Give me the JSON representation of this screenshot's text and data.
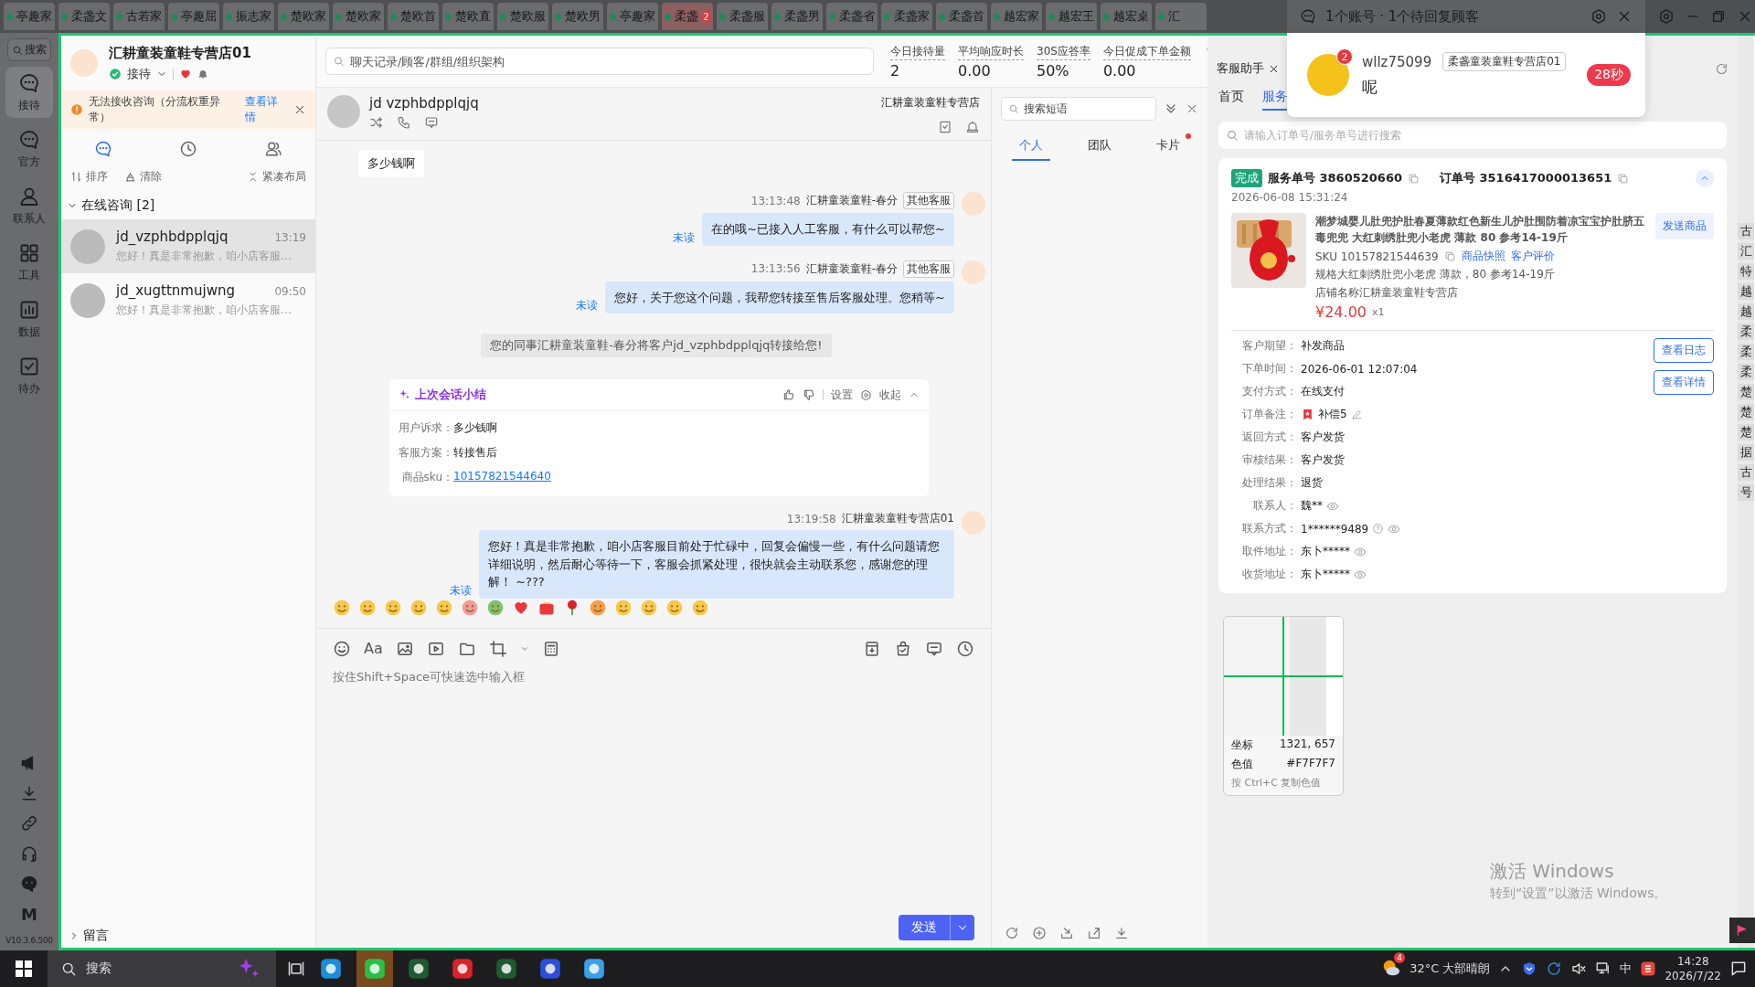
{
  "top_tabs": [
    {
      "label": "亭趣家",
      "alert": false
    },
    {
      "label": "柔盏文",
      "alert": false
    },
    {
      "label": "古若家",
      "alert": false
    },
    {
      "label": "亭趣屈",
      "alert": false
    },
    {
      "label": "振志家",
      "alert": false
    },
    {
      "label": "楚欧家",
      "alert": false
    },
    {
      "label": "楚欧家",
      "alert": false
    },
    {
      "label": "楚欧首",
      "alert": false
    },
    {
      "label": "楚欧直",
      "alert": false
    },
    {
      "label": "楚欧服",
      "alert": false
    },
    {
      "label": "楚欧男",
      "alert": false
    },
    {
      "label": "亭趣家",
      "alert": false
    },
    {
      "label": "柔盏",
      "alert": true,
      "badge": "2"
    },
    {
      "label": "柔盏服",
      "alert": false
    },
    {
      "label": "柔盏男",
      "alert": false
    },
    {
      "label": "柔盏省",
      "alert": false
    },
    {
      "label": "柔盏家",
      "alert": false
    },
    {
      "label": "柔盏首",
      "alert": false
    },
    {
      "label": "越宏家",
      "alert": false
    },
    {
      "label": "越宏王",
      "alert": false
    },
    {
      "label": "越宏桌",
      "alert": false
    },
    {
      "label": "汇",
      "alert": false
    }
  ],
  "notification": {
    "title": "1个账号 · 1个待回复顾客",
    "customer": "wllz75099",
    "badge": "2",
    "shop_tag": "柔盏童装童鞋专营店01",
    "message": "呢",
    "timer": "28秒"
  },
  "rail": {
    "search": "搜索",
    "items": [
      {
        "label": "接待",
        "selected": true
      },
      {
        "label": "官方",
        "selected": false
      },
      {
        "label": "联系人",
        "selected": false
      },
      {
        "label": "工具",
        "selected": false
      },
      {
        "label": "数据",
        "selected": false
      },
      {
        "label": "待办",
        "selected": false
      }
    ],
    "logo_letter": "M",
    "version": "V10.3.6.500"
  },
  "shop": {
    "name": "汇耕童装童鞋专营店01",
    "status": "接待"
  },
  "warning": {
    "text": "无法接收咨询（分流权重异常）",
    "link": "查看详情"
  },
  "list_tabs": [
    {
      "selected": true
    },
    {
      "selected": false
    },
    {
      "selected": false
    }
  ],
  "list_actions": [
    "排序",
    "清除",
    "紧凑布局"
  ],
  "group": {
    "label": "在线咨询 [2]",
    "expanded": true
  },
  "conversations": [
    {
      "name": "jd_vzphbdpplqjq",
      "time": "13:19",
      "preview": "您好！真是非常抱歉，咱小店客服…",
      "selected": true
    },
    {
      "name": "jd_xugttnmujwng",
      "time": "09:50",
      "preview": "您好！真是非常抱歉，咱小店客服…",
      "selected": false
    }
  ],
  "footer_group": {
    "label": "留言",
    "expanded": false
  },
  "search": {
    "placeholder": "聊天记录/顾客/群组/组织架构"
  },
  "stats": [
    {
      "label": "今日接待量",
      "value": "2"
    },
    {
      "label": "平均响应时长",
      "value": "0.00"
    },
    {
      "label": "30S应答率",
      "value": "50%"
    },
    {
      "label": "今日促成下单金额",
      "value": "0.00"
    }
  ],
  "chat": {
    "customer": "jd vzphbdpplqjq",
    "shop": "汇耕童装童鞋专营店",
    "messages": [
      {
        "kind": "incoming",
        "text": "多少钱啊"
      },
      {
        "kind": "outgoing",
        "time": "13:13:48",
        "sender": "汇耕童装童鞋-春分",
        "tag": "其他客服",
        "text": "在的哦~已接入人工客服，有什么可以帮您~",
        "status": "未读"
      },
      {
        "kind": "outgoing",
        "time": "13:13:56",
        "sender": "汇耕童装童鞋-春分",
        "tag": "其他客服",
        "text": "您好，关于您这个问题，我帮您转接至售后客服处理。您稍等~",
        "status": "未读"
      },
      {
        "kind": "system",
        "text": "您的同事汇耕童装童鞋-春分将客户jd_vzphbdpplqjq转接给您!"
      },
      {
        "kind": "summary",
        "title": "上次会话小结",
        "settings": "设置",
        "collapse": "收起",
        "fields": [
          {
            "label": "用户诉求：",
            "value": "多少钱啊",
            "link": false
          },
          {
            "label": "客服方案：",
            "value": "转接售后",
            "link": false
          },
          {
            "label": "商品sku：",
            "value": "10157821544640",
            "link": true
          }
        ]
      },
      {
        "kind": "outgoing",
        "time": "13:19:58",
        "sender": "汇耕童装童鞋专营店01",
        "text": "您好！真是非常抱歉，咱小店客服目前处于忙碌中，回复会偏慢一些，有什么问题请您详细说明，然后耐心等待一下，客服会抓紧处理，很快就会主动联系您，感谢您的理解！ ~???",
        "status": "未读"
      }
    ]
  },
  "composer": {
    "font_button": "Aa",
    "placeholder": "按住Shift+Space可快速选中输入框",
    "send": "发送"
  },
  "phrases": {
    "search_placeholder": "搜索短语",
    "tabs": [
      {
        "label": "个人",
        "selected": true,
        "dot": false
      },
      {
        "label": "团队",
        "selected": false,
        "dot": false
      },
      {
        "label": "卡片",
        "selected": false,
        "dot": true
      }
    ]
  },
  "assistant": {
    "tab": "客服助手",
    "subtabs": [
      {
        "label": "首页",
        "selected": false
      },
      {
        "label": "服务",
        "selected": true
      }
    ],
    "search_placeholder": "请输入订单号/服务单号进行搜索",
    "order": {
      "status": "完成",
      "service_no": "服务单号 3860520660",
      "order_no": "订单号 3516417000013651",
      "date": "2026-06-08 15:31:24",
      "expanded": true,
      "product": {
        "title": "潮梦城婴儿肚兜护肚春夏薄款红色新生儿护肚围防着凉宝宝护肚脐五毒兜兜 大红刺绣肚兜小老虎 薄款 80 参考14-19斤",
        "sku": "SKU 10157821544639",
        "links": [
          "商品快照",
          "客户评价"
        ],
        "spec": "规格大红刺绣肚兜小老虎 薄款，80 参考14-19斤",
        "shop": "店铺名称汇耕童装童鞋专营店",
        "price": "¥24.00",
        "qty": "x1",
        "send": "发送商品"
      },
      "buttons": [
        "查看日志",
        "查看详情"
      ],
      "fields": [
        {
          "kind": "plain",
          "label": "客户期望：",
          "value": "补发商品"
        },
        {
          "kind": "plain",
          "label": "下单时间：",
          "value": "2026-06-01 12:07:04"
        },
        {
          "kind": "plain",
          "label": "支付方式：",
          "value": "在线支付"
        },
        {
          "kind": "note",
          "label": "订单备注：",
          "value": "补偿5"
        },
        {
          "kind": "plain",
          "label": "返回方式：",
          "value": "客户发货"
        },
        {
          "kind": "plain",
          "label": "审核结果：",
          "value": "客户发货"
        },
        {
          "kind": "plain",
          "label": "处理结果：",
          "value": "退货"
        },
        {
          "kind": "masked",
          "label": "联系人：",
          "value": "魏**"
        },
        {
          "kind": "masked_help",
          "label": "联系方式：",
          "value": "1******9489"
        },
        {
          "kind": "masked",
          "label": "取件地址：",
          "value": "东卜*****"
        },
        {
          "kind": "masked",
          "label": "收货地址：",
          "value": "东卜*****"
        }
      ]
    }
  },
  "side_strip": [
    "古",
    "汇",
    "特",
    "越",
    "越",
    "柔",
    "柔",
    "柔",
    "楚",
    "楚",
    "楚",
    "据",
    "古",
    "号"
  ],
  "color_picker": {
    "coord_label": "坐标",
    "coord": "1321, 657",
    "color_label": "色值",
    "color_value": "#F7F7F7",
    "hint": "按 Ctrl+C 复制色值"
  },
  "activation": {
    "title": "激活 Windows",
    "subtitle": "转到“设置”以激活 Windows。"
  },
  "taskbar": {
    "search": "搜索",
    "weather_badge": "4",
    "weather": "32°C 大部晴朗",
    "ime": "中",
    "time": "14:28",
    "date": "2026/7/22"
  }
}
